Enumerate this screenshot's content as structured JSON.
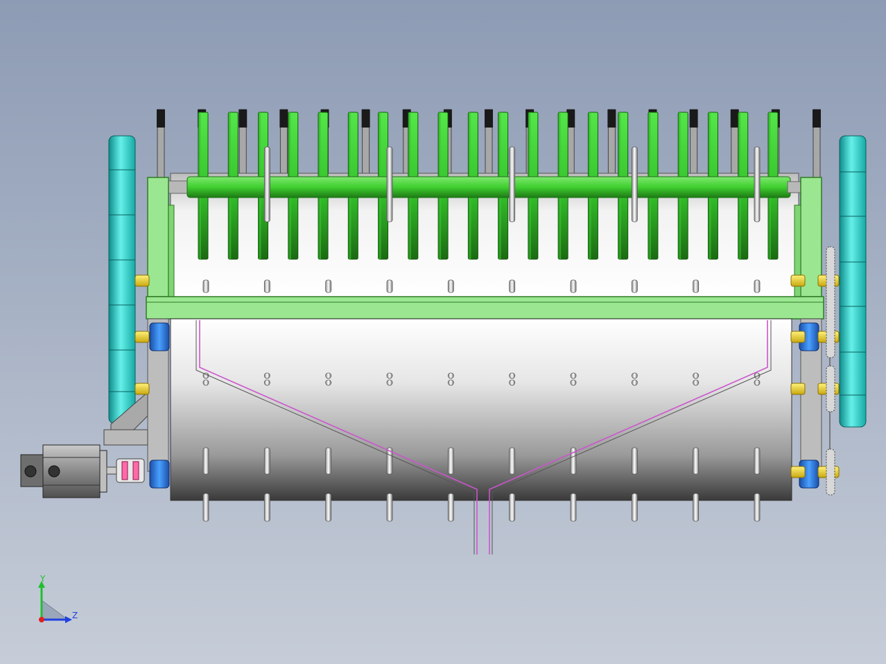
{
  "view": {
    "background_top": "#8d9bb4",
    "background_bottom": "#c6cdd8"
  },
  "model": {
    "tine_count": 20,
    "stopper_count": 17,
    "pin_columns": 10,
    "colors": {
      "tines": "#33cc33",
      "frame": "#9be690",
      "wheels": "#2fd3cf",
      "bearings": "#2e7bdc",
      "studs": "#e6c81e",
      "guide": "#cc55cc",
      "motor": "#8e8e8e"
    },
    "icons": {
      "motor": "servo-motor-icon",
      "coupling": "coupling-icon",
      "wheel": "ground-wheel-icon"
    }
  },
  "triad": {
    "y_label": "Y",
    "z_label": "Z",
    "colors": {
      "y": "#1fbf2f",
      "z": "#2040e0",
      "x": "#e02020"
    }
  }
}
